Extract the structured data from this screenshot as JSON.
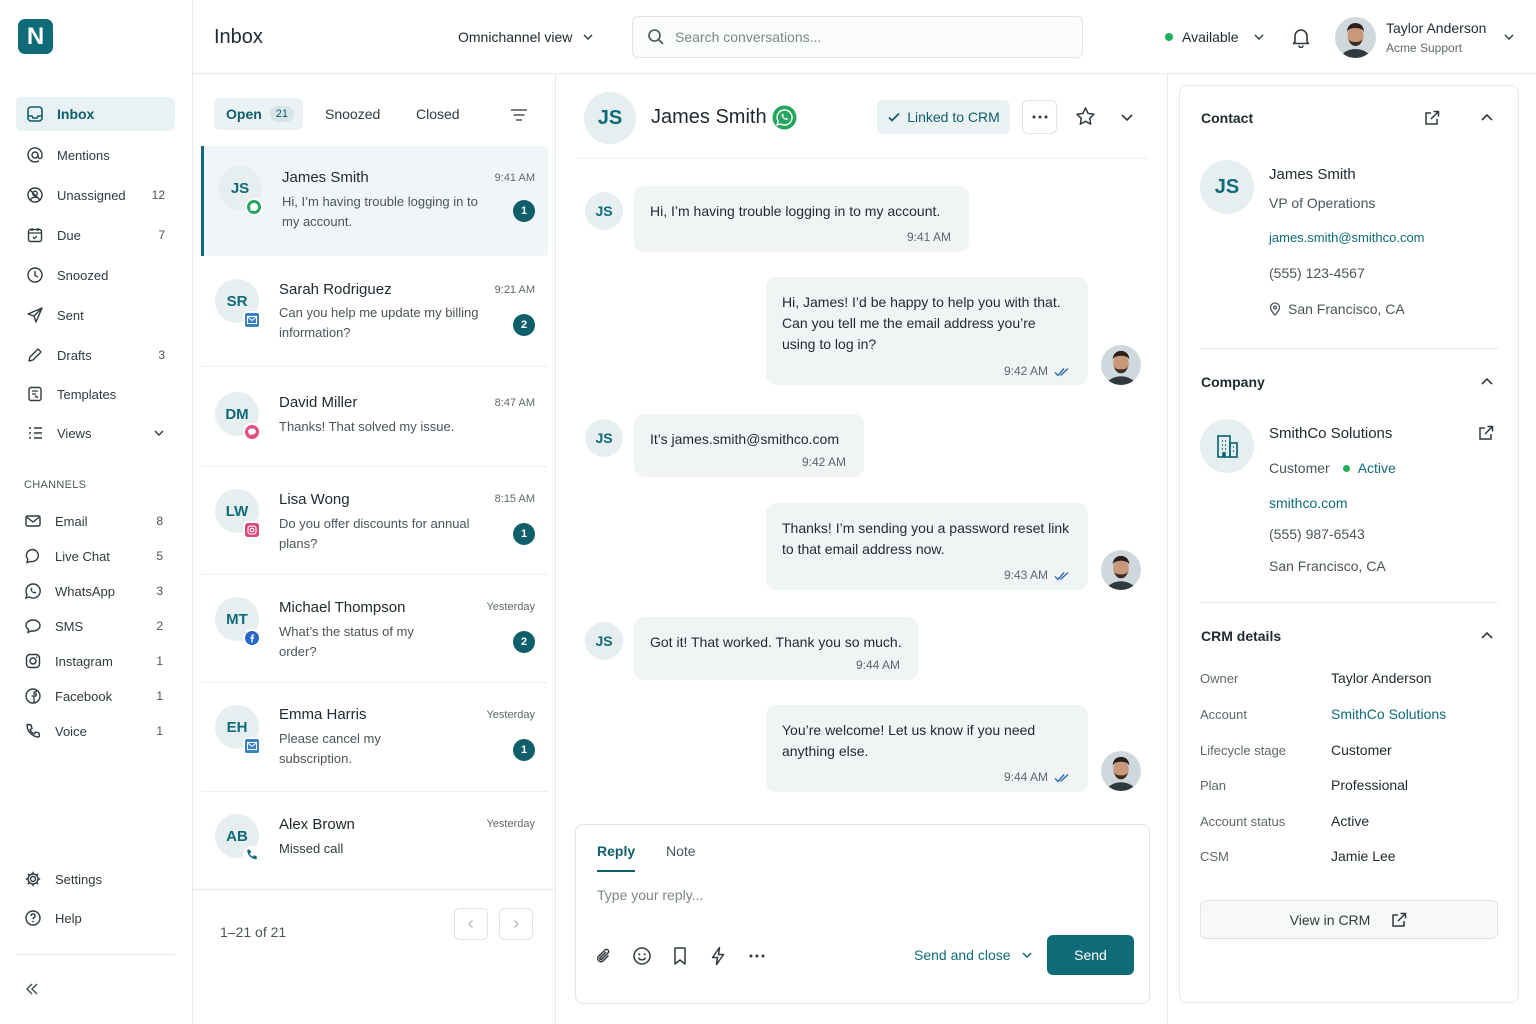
{
  "app": {
    "logo_letter": "N",
    "brand_color": "#0f6b78"
  },
  "sidebar": {
    "items": [
      {
        "label": "Inbox",
        "icon": "inbox-icon",
        "count": ""
      },
      {
        "label": "Mentions",
        "icon": "at-icon",
        "count": ""
      },
      {
        "label": "Unassigned",
        "icon": "unassigned-icon",
        "count": "12"
      },
      {
        "label": "Due",
        "icon": "calendar-icon",
        "count": "7"
      },
      {
        "label": "Snoozed",
        "icon": "clock-icon",
        "count": ""
      },
      {
        "label": "Sent",
        "icon": "send-icon",
        "count": ""
      },
      {
        "label": "Drafts",
        "icon": "pencil-icon",
        "count": "3"
      },
      {
        "label": "Templates",
        "icon": "template-icon",
        "count": ""
      },
      {
        "label": "Views",
        "icon": "views-icon",
        "count": ""
      }
    ],
    "channels_title": "CHANNELS",
    "channels": [
      {
        "label": "Email",
        "icon": "mail-icon",
        "count": "8"
      },
      {
        "label": "Live Chat",
        "icon": "chat-icon",
        "count": "5"
      },
      {
        "label": "WhatsApp",
        "icon": "whatsapp-icon",
        "count": "3"
      },
      {
        "label": "SMS",
        "icon": "sms-icon",
        "count": "2"
      },
      {
        "label": "Instagram",
        "icon": "instagram-icon",
        "count": "1"
      },
      {
        "label": "Facebook",
        "icon": "facebook-icon",
        "count": "1"
      },
      {
        "label": "Voice",
        "icon": "phone-icon",
        "count": "1"
      }
    ],
    "settings": "Settings",
    "help": "Help"
  },
  "topbar": {
    "title": "Inbox",
    "view_selector": "Omnichannel view",
    "search_placeholder": "Search conversations...",
    "status": "Available",
    "user_name": "Taylor Anderson",
    "user_org": "Acme Support"
  },
  "conversations": {
    "tabs": [
      {
        "label": "Open",
        "count": "21"
      },
      {
        "label": "Snoozed"
      },
      {
        "label": "Closed"
      }
    ],
    "items": [
      {
        "initials": "JS",
        "name": "James Smith",
        "time": "9:41 AM",
        "preview": "Hi, I’m having trouble logging in to my account.",
        "unread": "1",
        "channel": "whatsapp"
      },
      {
        "initials": "SR",
        "name": "Sarah Rodriguez",
        "time": "9:21 AM",
        "preview": "Can you help me update my billing information?",
        "unread": "2",
        "channel": "email"
      },
      {
        "initials": "DM",
        "name": "David Miller",
        "time": "8:47 AM",
        "preview": "Thanks! That solved my issue.",
        "unread": "",
        "channel": "chat"
      },
      {
        "initials": "LW",
        "name": "Lisa Wong",
        "time": "8:15 AM",
        "preview": "Do you offer discounts for annual plans?",
        "unread": "1",
        "channel": "instagram"
      },
      {
        "initials": "MT",
        "name": "Michael Thompson",
        "time": "Yesterday",
        "preview": "What’s the status of my order?",
        "unread": "2",
        "channel": "facebook"
      },
      {
        "initials": "EH",
        "name": "Emma Harris",
        "time": "Yesterday",
        "preview": "Please cancel my subscription.",
        "unread": "1",
        "channel": "email"
      },
      {
        "initials": "AB",
        "name": "Alex Brown",
        "time": "Yesterday",
        "preview": "Missed call",
        "unread": "",
        "channel": "phone"
      }
    ],
    "pagination": "1–21 of 21"
  },
  "chat": {
    "contact_initials": "JS",
    "contact_name": "James Smith",
    "crm_status": "Linked to CRM",
    "messages": [
      {
        "from": "customer",
        "text": "Hi, I’m having trouble logging in to my account.",
        "time": "9:41 AM"
      },
      {
        "from": "agent",
        "text": "Hi, James! I’d be happy to help you with that. Can you tell me the email address you’re using to log in?",
        "time": "9:42 AM"
      },
      {
        "from": "customer",
        "text": "It’s james.smith@smithco.com",
        "time": "9:42 AM"
      },
      {
        "from": "agent",
        "text": "Thanks! I’m sending you a password reset link to that email address now.",
        "time": "9:43 AM"
      },
      {
        "from": "customer",
        "text": "Got it! That worked. Thank you so much.",
        "time": "9:44 AM"
      },
      {
        "from": "agent",
        "text": "You’re welcome! Let us know if you need anything else.",
        "time": "9:44 AM"
      }
    ],
    "composer": {
      "tab_reply": "Reply",
      "tab_note": "Note",
      "placeholder": "Type your reply...",
      "send_close": "Send and close",
      "send": "Send"
    }
  },
  "contact_panel": {
    "contact_title": "Contact",
    "initials": "JS",
    "name": "James Smith",
    "role": "VP of Operations",
    "email": "james.smith@smithco.com",
    "phone": "(555) 123-4567",
    "location": "San Francisco, CA",
    "company_title": "Company",
    "company_name": "SmithCo Solutions",
    "company_type": "Customer",
    "company_status": "Active",
    "company_site": "smithco.com",
    "company_phone": "(555) 987-6543",
    "company_location": "San Francisco, CA",
    "crm_title": "CRM details",
    "crm": [
      {
        "k": "Owner",
        "v": "Taylor Anderson"
      },
      {
        "k": "Account",
        "v": "SmithCo Solutions"
      },
      {
        "k": "Lifecycle stage",
        "v": "Customer"
      },
      {
        "k": "Plan",
        "v": "Professional"
      },
      {
        "k": "Account status",
        "v": "Active"
      },
      {
        "k": "CSM",
        "v": "Jamie Lee"
      }
    ],
    "view_in_crm": "View in CRM"
  }
}
